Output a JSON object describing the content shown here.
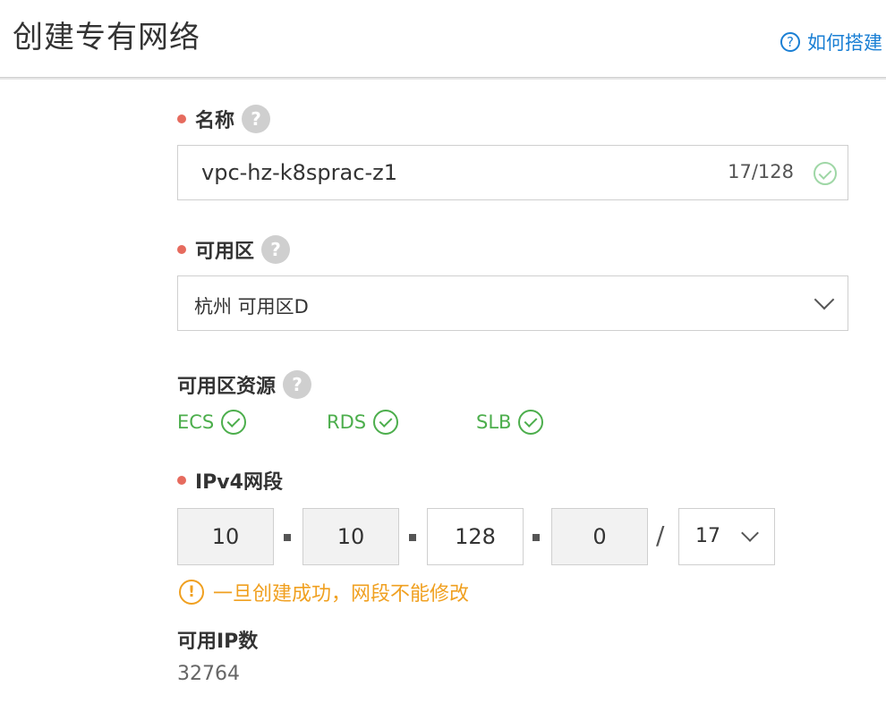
{
  "header": {
    "title": "创建专有网络",
    "help_text": "如何搭建"
  },
  "form": {
    "name": {
      "label": "名称",
      "value": "vpc-hz-k8sprac-z1",
      "count": "17/128"
    },
    "zone": {
      "label": "可用区",
      "value": "杭州 可用区D"
    },
    "resources": {
      "label": "可用区资源",
      "items": [
        "ECS",
        "RDS",
        "SLB"
      ]
    },
    "ipv4": {
      "label": "IPv4网段",
      "octets": [
        "10",
        "10",
        "128",
        "0"
      ],
      "separator": "/",
      "mask": "17",
      "warning": "一旦创建成功，网段不能修改"
    },
    "available_ip": {
      "label": "可用IP数",
      "value": "32764"
    }
  },
  "icons": {
    "help": "question-circle-icon",
    "check": "check-circle-icon",
    "warning": "exclamation-circle-icon",
    "dropdown": "chevron-down-icon"
  },
  "colors": {
    "accent": "#1a7fd4",
    "required": "#e66b5e",
    "success": "#4cae4c",
    "warning": "#f0a020"
  }
}
